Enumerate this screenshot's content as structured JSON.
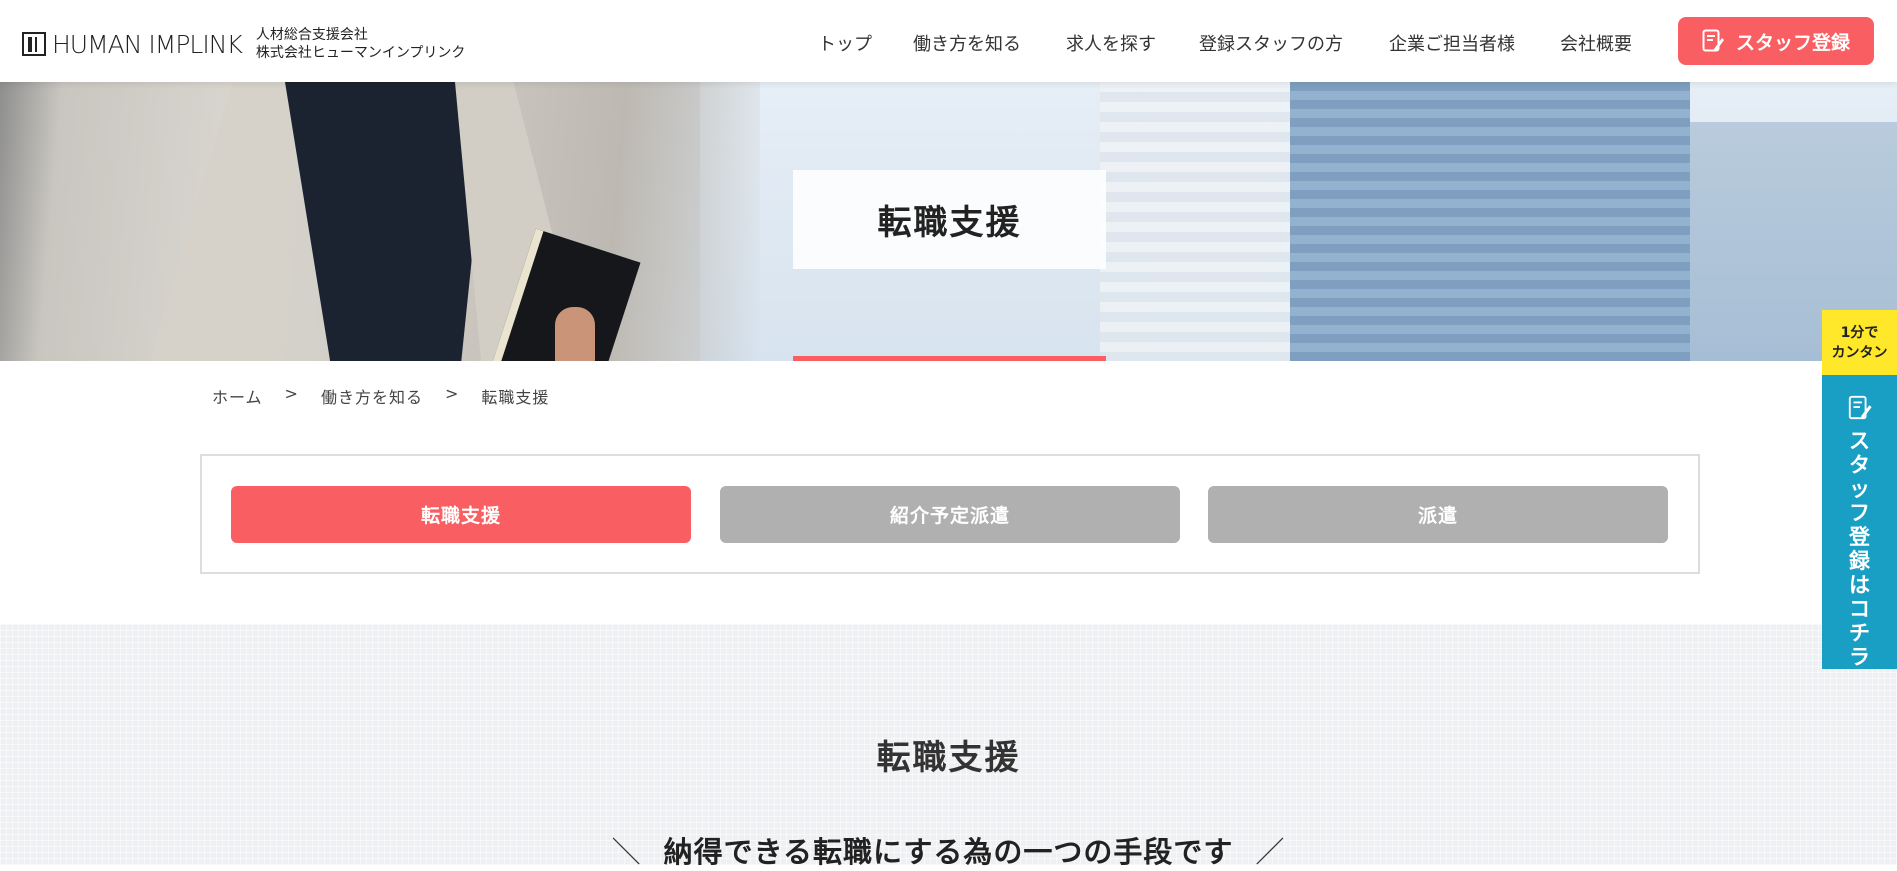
{
  "logo": {
    "brand": "HUMAN IMPLINK",
    "sub_line1": "人材総合支援会社",
    "sub_line2": "株式会社ヒューマンインプリンク"
  },
  "nav": {
    "items": [
      "トップ",
      "働き方を知る",
      "求人を探す",
      "登録スタッフの方",
      "企業ご担当者様",
      "会社概要"
    ],
    "register_label": "スタッフ登録"
  },
  "hero": {
    "title": "転職支援"
  },
  "breadcrumb": {
    "items": [
      "ホーム",
      "働き方を知る",
      "転職支援"
    ],
    "separator": ">"
  },
  "tabs": [
    {
      "label": "転職支援",
      "active": true,
      "color": "#f95e62"
    },
    {
      "label": "紹介予定派遣",
      "active": false,
      "color": "#b0b0b0"
    },
    {
      "label": "派遣",
      "active": false,
      "color": "#b0b0b0"
    }
  ],
  "section": {
    "title": "転職支援",
    "subtitle": "納得できる転職にする為の一つの手段です",
    "slash_left": "＼",
    "slash_right": "／"
  },
  "side_cta": {
    "top_line1": "1分で",
    "top_line2": "カンタン",
    "body": "スタッフ登録はコチラ"
  },
  "colors": {
    "accent": "#f95e62",
    "side_blue": "#199fc4",
    "side_yellow": "#ffe72a",
    "tab_inactive": "#b0b0b0"
  },
  "icons": [
    "memo-icon"
  ]
}
